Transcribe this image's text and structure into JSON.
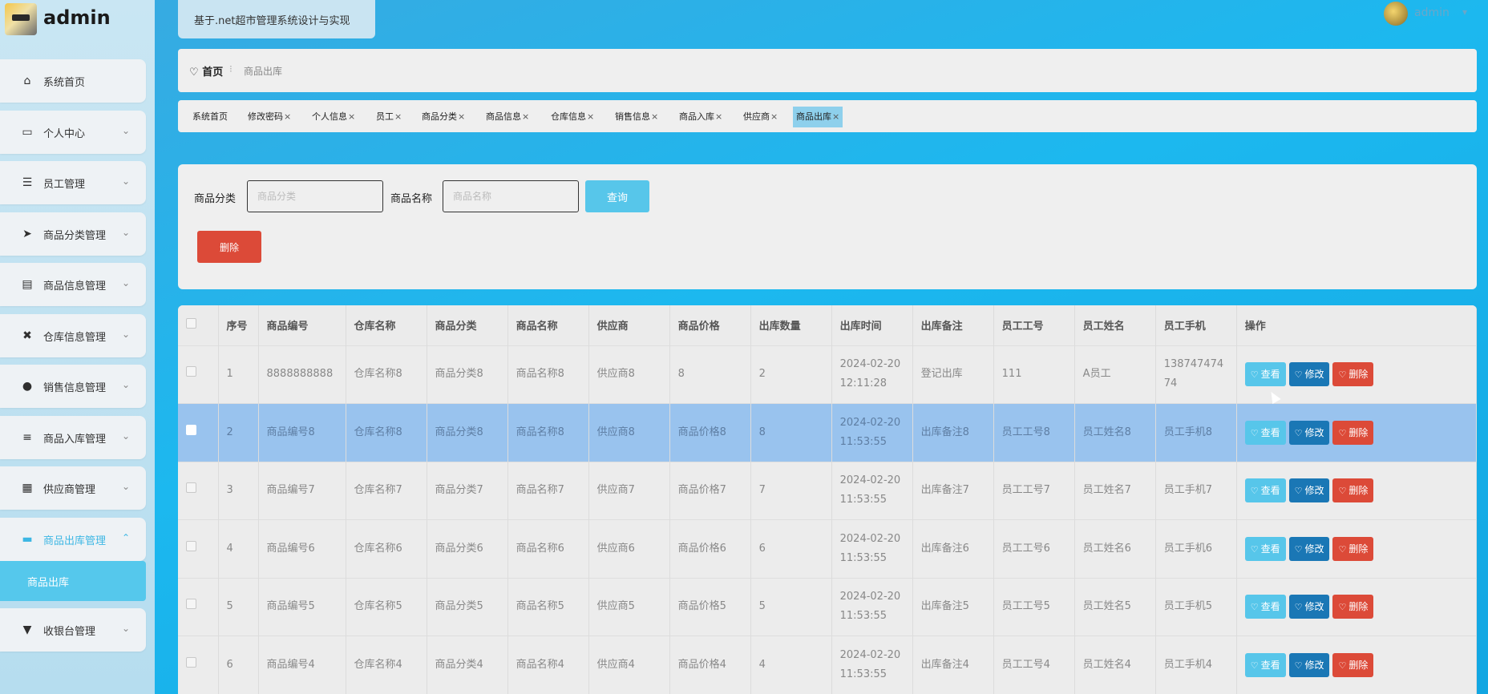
{
  "brand": {
    "name": "admin",
    "logo_icon": "user-avatar-icon"
  },
  "header": {
    "site_title": "基于.net超市管理系统设计与实现",
    "user_name": "admin",
    "caret": "▾"
  },
  "sidebar": {
    "items": [
      {
        "label": "系统首页",
        "icon": "⌂",
        "chevron": ""
      },
      {
        "label": "个人中心",
        "icon": "▭",
        "chevron": "⌄"
      },
      {
        "label": "员工管理",
        "icon": "☰",
        "chevron": "⌄"
      },
      {
        "label": "商品分类管理",
        "icon": "➤",
        "chevron": "⌄"
      },
      {
        "label": "商品信息管理",
        "icon": "▤",
        "chevron": "⌄"
      },
      {
        "label": "仓库信息管理",
        "icon": "✖",
        "chevron": "⌄"
      },
      {
        "label": "销售信息管理",
        "icon": "●",
        "chevron": "⌄"
      },
      {
        "label": "商品入库管理",
        "icon": "≡",
        "chevron": "⌄"
      },
      {
        "label": "供应商管理",
        "icon": "▦",
        "chevron": "⌄"
      },
      {
        "label": "商品出库管理",
        "icon": "▬",
        "chevron": "⌃"
      },
      {
        "label": "收银台管理",
        "icon": "▼",
        "chevron": "⌄"
      }
    ],
    "active_sub": "商品出库"
  },
  "breadcrumb": {
    "home": "首页",
    "separator": "⁝",
    "current": "商品出库"
  },
  "tabs": [
    {
      "label": "系统首页",
      "close": ""
    },
    {
      "label": "修改密码",
      "close": "×"
    },
    {
      "label": "个人信息",
      "close": "×"
    },
    {
      "label": "员工",
      "close": "×"
    },
    {
      "label": "商品分类",
      "close": "×"
    },
    {
      "label": "商品信息",
      "close": "×"
    },
    {
      "label": "仓库信息",
      "close": "×"
    },
    {
      "label": "销售信息",
      "close": "×"
    },
    {
      "label": "商品入库",
      "close": "×"
    },
    {
      "label": "供应商",
      "close": "×"
    },
    {
      "label": "商品出库",
      "close": "×"
    }
  ],
  "search": {
    "category_label": "商品分类",
    "category_placeholder": "商品分类",
    "name_label": "商品名称",
    "name_placeholder": "商品名称",
    "query_button": "查询",
    "delete_button": "删除"
  },
  "table": {
    "headers": [
      "",
      "序号",
      "商品编号",
      "仓库名称",
      "商品分类",
      "商品名称",
      "供应商",
      "商品价格",
      "出库数量",
      "出库时间",
      "出库备注",
      "员工工号",
      "员工姓名",
      "员工手机",
      "操作"
    ],
    "actions": {
      "view": "查看",
      "edit": "修改",
      "delete": "删除"
    },
    "rows": [
      [
        "1",
        "8888888888",
        "仓库名称8",
        "商品分类8",
        "商品名称8",
        "供应商8",
        "8",
        "2",
        "2024-02-20 12:11:28",
        "登记出库",
        "111",
        "A员工",
        "13874747474"
      ],
      [
        "2",
        "商品编号8",
        "仓库名称8",
        "商品分类8",
        "商品名称8",
        "供应商8",
        "商品价格8",
        "8",
        "2024-02-20 11:53:55",
        "出库备注8",
        "员工工号8",
        "员工姓名8",
        "员工手机8"
      ],
      [
        "3",
        "商品编号7",
        "仓库名称7",
        "商品分类7",
        "商品名称7",
        "供应商7",
        "商品价格7",
        "7",
        "2024-02-20 11:53:55",
        "出库备注7",
        "员工工号7",
        "员工姓名7",
        "员工手机7"
      ],
      [
        "4",
        "商品编号6",
        "仓库名称6",
        "商品分类6",
        "商品名称6",
        "供应商6",
        "商品价格6",
        "6",
        "2024-02-20 11:53:55",
        "出库备注6",
        "员工工号6",
        "员工姓名6",
        "员工手机6"
      ],
      [
        "5",
        "商品编号5",
        "仓库名称5",
        "商品分类5",
        "商品名称5",
        "供应商5",
        "商品价格5",
        "5",
        "2024-02-20 11:53:55",
        "出库备注5",
        "员工工号5",
        "员工姓名5",
        "员工手机5"
      ],
      [
        "6",
        "商品编号4",
        "仓库名称4",
        "商品分类4",
        "商品名称4",
        "供应商4",
        "商品价格4",
        "4",
        "2024-02-20 11:53:55",
        "出库备注4",
        "员工工号4",
        "员工姓名4",
        "员工手机4"
      ]
    ],
    "selected_row": 1
  },
  "colors": {
    "accent": "#55c8ec",
    "danger": "#dc4a38",
    "primary": "#1a77b5",
    "selected_row": "#99c3ee"
  }
}
